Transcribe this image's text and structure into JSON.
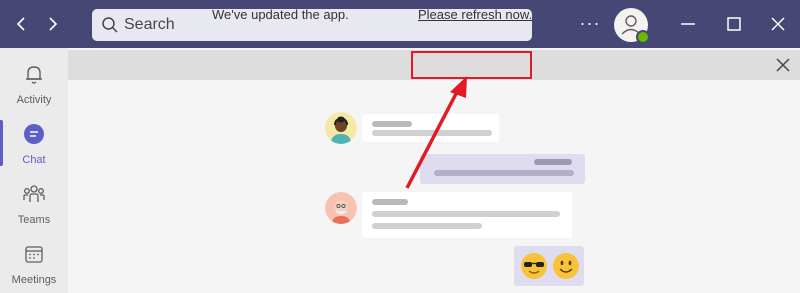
{
  "titlebar": {
    "back_label": "‹",
    "forward_label": "›",
    "search": {
      "placeholder": "Search"
    },
    "more_label": "···"
  },
  "rail": {
    "items": [
      {
        "id": "activity",
        "label": "Activity",
        "icon": "bell-icon",
        "active": false
      },
      {
        "id": "chat",
        "label": "Chat",
        "icon": "chat-icon",
        "active": true
      },
      {
        "id": "teams",
        "label": "Teams",
        "icon": "teams-icon",
        "active": false
      },
      {
        "id": "meetings",
        "label": "Meetings",
        "icon": "calendar-icon",
        "active": false
      }
    ]
  },
  "banner": {
    "message": "We've updated the app.",
    "link": "Please refresh now."
  },
  "colors": {
    "titlebar": "#464775",
    "accent": "#5b5fc7",
    "presence": "#6bb700",
    "highlight": "#e01b24"
  }
}
